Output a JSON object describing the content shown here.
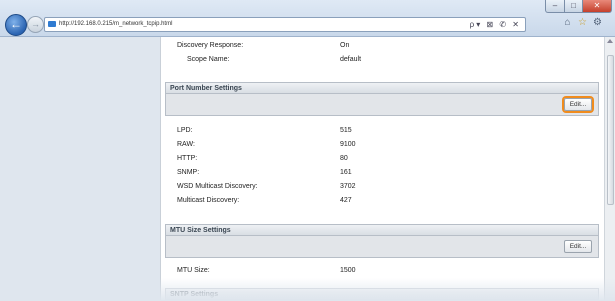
{
  "browser": {
    "url": "http://192.168.0.215/m_network_tcpip.html",
    "window_controls": [
      "–",
      "□",
      "✕"
    ],
    "address_tools": "ρ▾ ⊠ ✆ ✕",
    "accent_color": "#f08c1e"
  },
  "top_rows": [
    {
      "label": "Discovery Response:",
      "value": "On"
    },
    {
      "label": "Scope Name:",
      "value": "default"
    }
  ],
  "port_section": {
    "title": "Port Number Settings",
    "edit_label": "Edit...",
    "rows": [
      {
        "label": "LPD:",
        "value": "515"
      },
      {
        "label": "RAW:",
        "value": "9100"
      },
      {
        "label": "HTTP:",
        "value": "80"
      },
      {
        "label": "SNMP:",
        "value": "161"
      },
      {
        "label": "WSD Multicast Discovery:",
        "value": "3702"
      },
      {
        "label": "Multicast Discovery:",
        "value": "427"
      }
    ]
  },
  "mtu_section": {
    "title": "MTU Size Settings",
    "edit_label": "Edit...",
    "rows": [
      {
        "label": "MTU Size:",
        "value": "1500"
      }
    ]
  },
  "next_section": {
    "title": "SNTP Settings"
  }
}
